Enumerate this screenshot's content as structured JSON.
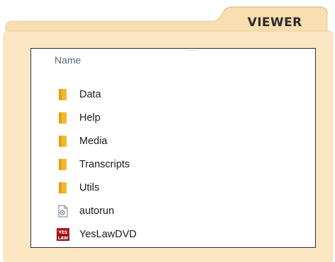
{
  "viewer": {
    "tab_title": "VIEWER",
    "column_header": "Name",
    "items": [
      {
        "label": "Data",
        "icon": "folder-icon"
      },
      {
        "label": "Help",
        "icon": "folder-icon"
      },
      {
        "label": "Media",
        "icon": "folder-icon"
      },
      {
        "label": "Transcripts",
        "icon": "folder-icon"
      },
      {
        "label": "Utils",
        "icon": "folder-icon"
      },
      {
        "label": "autorun",
        "icon": "setup-file-icon"
      },
      {
        "label": "YesLawDVD",
        "icon": "yeslaw-app-icon"
      }
    ],
    "logo_text_top": "YES",
    "logo_text_bottom": "LAW"
  },
  "colors": {
    "folder_body": "#fbe7c3",
    "folder_tab": "#f8deb0",
    "folder_icon": "#f2b92c",
    "app_icon_red": "#b3141b"
  }
}
